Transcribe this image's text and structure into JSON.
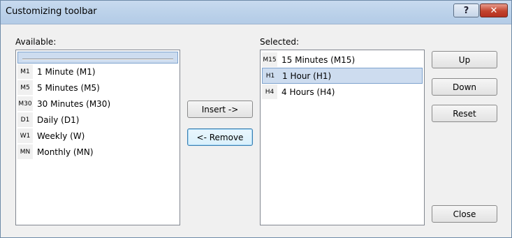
{
  "window": {
    "title": "Customizing toolbar",
    "help_label": "?",
    "close_label": "✕"
  },
  "available": {
    "label": "Available:",
    "items": [
      {
        "code": "",
        "label": ""
      },
      {
        "code": "M1",
        "label": "1 Minute (M1)"
      },
      {
        "code": "M5",
        "label": "5 Minutes (M5)"
      },
      {
        "code": "M30",
        "label": "30 Minutes (M30)"
      },
      {
        "code": "D1",
        "label": "Daily (D1)"
      },
      {
        "code": "W1",
        "label": "Weekly (W)"
      },
      {
        "code": "MN",
        "label": "Monthly (MN)"
      }
    ]
  },
  "selected": {
    "label": "Selected:",
    "items": [
      {
        "code": "M15",
        "label": "15 Minutes (M15)"
      },
      {
        "code": "H1",
        "label": "1 Hour (H1)"
      },
      {
        "code": "H4",
        "label": "4 Hours (H4)"
      }
    ]
  },
  "buttons": {
    "insert": "Insert ->",
    "remove": "<- Remove",
    "up": "Up",
    "down": "Down",
    "reset": "Reset",
    "close": "Close"
  }
}
